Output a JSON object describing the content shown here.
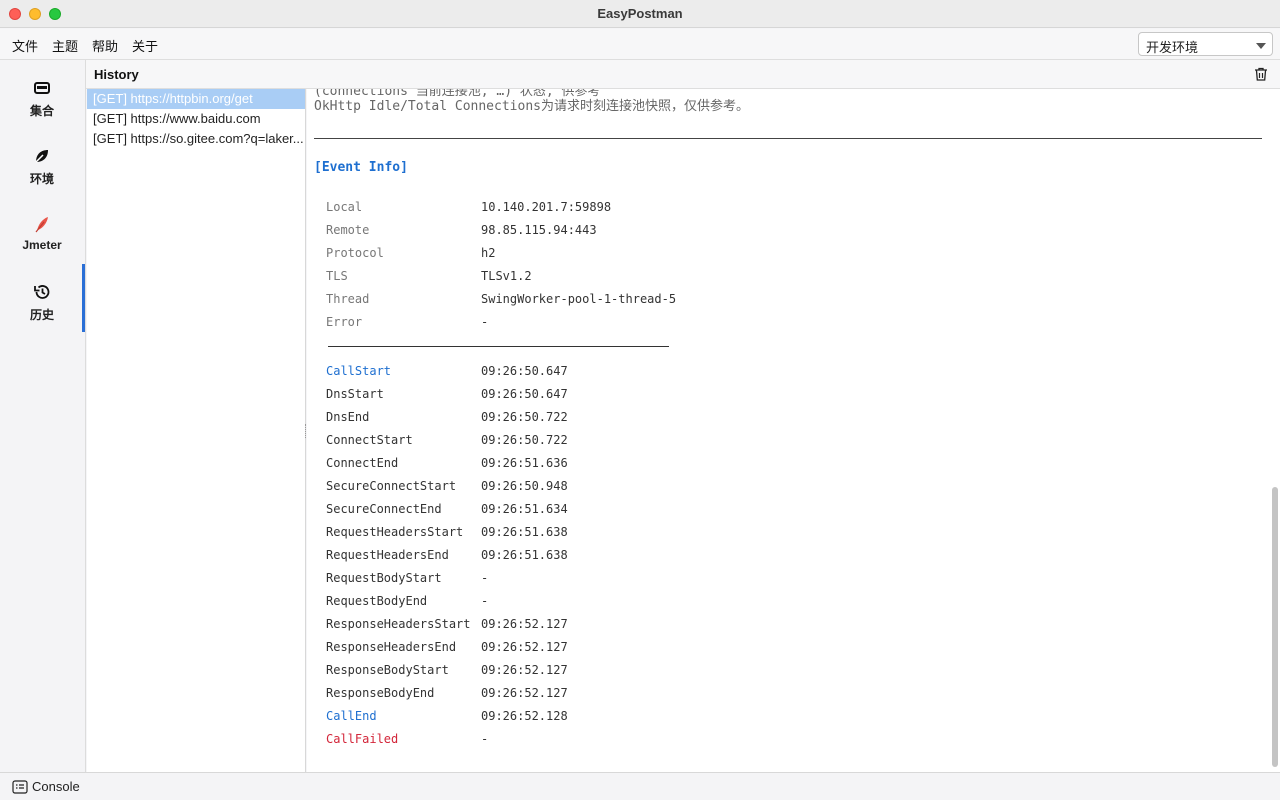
{
  "window": {
    "title": "EasyPostman"
  },
  "menu": {
    "items": [
      "文件",
      "主题",
      "帮助",
      "关于"
    ]
  },
  "environment": {
    "selected": "开发环境"
  },
  "nav": [
    {
      "label": "集合",
      "icon": "collection-icon"
    },
    {
      "label": "环境",
      "icon": "leaf-icon"
    },
    {
      "label": "Jmeter",
      "icon": "feather-icon"
    },
    {
      "label": "历史",
      "icon": "history-icon"
    }
  ],
  "history": {
    "title": "History",
    "items": [
      "[GET] https://httpbin.org/get",
      "[GET] https://www.baidu.com",
      "[GET] https://so.gitee.com?q=laker..."
    ]
  },
  "detail": {
    "note_clipped": "(connections 当前连接池, …) 状态, 供参考",
    "note": "OkHttp Idle/Total Connections为请求时刻连接池快照，仅供参考。",
    "event_title": "[Event Info]",
    "info_rows": [
      {
        "label": "Local",
        "value": "10.140.201.7:59898"
      },
      {
        "label": "Remote",
        "value": "98.85.115.94:443"
      },
      {
        "label": "Protocol",
        "value": "h2"
      },
      {
        "label": "TLS",
        "value": "TLSv1.2"
      },
      {
        "label": "Thread",
        "value": "SwingWorker-pool-1-thread-5"
      },
      {
        "label": "Error",
        "value": "-"
      }
    ],
    "timing_rows": [
      {
        "label": "CallStart",
        "value": "09:26:50.647",
        "color": "blue"
      },
      {
        "label": "DnsStart",
        "value": "09:26:50.647",
        "color": "normal"
      },
      {
        "label": "DnsEnd",
        "value": "09:26:50.722",
        "color": "normal"
      },
      {
        "label": "ConnectStart",
        "value": "09:26:50.722",
        "color": "normal"
      },
      {
        "label": "ConnectEnd",
        "value": "09:26:51.636",
        "color": "normal"
      },
      {
        "label": "SecureConnectStart",
        "value": "09:26:50.948",
        "color": "normal"
      },
      {
        "label": "SecureConnectEnd",
        "value": "09:26:51.634",
        "color": "normal"
      },
      {
        "label": "RequestHeadersStart",
        "value": "09:26:51.638",
        "color": "normal"
      },
      {
        "label": "RequestHeadersEnd",
        "value": "09:26:51.638",
        "color": "normal"
      },
      {
        "label": "RequestBodyStart",
        "value": "-",
        "color": "normal"
      },
      {
        "label": "RequestBodyEnd",
        "value": "-",
        "color": "normal"
      },
      {
        "label": "ResponseHeadersStart",
        "value": "09:26:52.127",
        "color": "normal"
      },
      {
        "label": "ResponseHeadersEnd",
        "value": "09:26:52.127",
        "color": "normal"
      },
      {
        "label": "ResponseBodyStart",
        "value": "09:26:52.127",
        "color": "normal"
      },
      {
        "label": "ResponseBodyEnd",
        "value": "09:26:52.127",
        "color": "normal"
      },
      {
        "label": "CallEnd",
        "value": "09:26:52.128",
        "color": "blue"
      },
      {
        "label": "CallFailed",
        "value": "-",
        "color": "red"
      }
    ]
  },
  "statusbar": {
    "console_label": "Console"
  },
  "colors": {
    "accent": "#1e6fd0",
    "error": "#d3263a",
    "selection": "#a9cdf5"
  }
}
